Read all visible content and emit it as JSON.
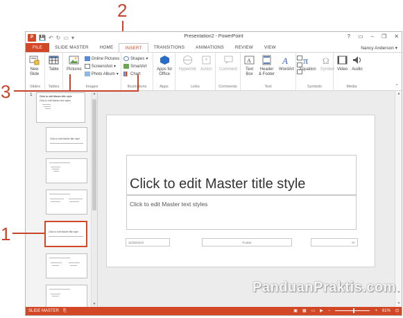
{
  "callouts": {
    "one": "1",
    "two": "2",
    "three": "3"
  },
  "window": {
    "title": "Presentation2 - PowerPoint",
    "help": "?",
    "min": "–",
    "restore": "❐",
    "close": "✕"
  },
  "tabs": {
    "file": "FILE",
    "slide_master": "SLIDE MASTER",
    "home": "HOME",
    "insert": "INSERT",
    "transitions": "TRANSITIONS",
    "animations": "ANIMATIONS",
    "review": "REVIEW",
    "view": "VIEW"
  },
  "user": "Nancy Anderson",
  "ribbon": {
    "new_slide": "New\nSlide",
    "table": "Table",
    "pictures": "Pictures",
    "online_pictures": "Online Pictures",
    "screenshot": "Screenshot",
    "photo_album": "Photo Album",
    "shapes": "Shapes",
    "smartart": "SmartArt",
    "chart": "Chart",
    "apps_for_office": "Apps for\nOffice",
    "hyperlink": "Hyperlink",
    "action": "Action",
    "comment": "Comment",
    "text_box": "Text\nBox",
    "header_footer": "Header\n& Footer",
    "wordart": "WordArt",
    "equation": "Equation",
    "symbol": "Symbol",
    "video": "Video",
    "audio": "Audio",
    "groups": {
      "slides": "Slides",
      "tables": "Tables",
      "images": "Images",
      "illustrations": "Illustrations",
      "apps": "Apps",
      "links": "Links",
      "comments": "Comments",
      "text": "Text",
      "symbols": "Symbols",
      "media": "Media"
    }
  },
  "thumbs": {
    "slide_number": "1",
    "master_title": "Click to edit Master title style",
    "master_text": "Click to edit Master text styles",
    "layout_title": "Click to edit Master title style"
  },
  "slide": {
    "title": "Click to edit Master title style",
    "body": "Click to edit Master text styles",
    "date": "11/25/2012",
    "footer": "Footer",
    "number": "‹#›"
  },
  "status": {
    "view": "SLIDE MASTER",
    "zoom": "61%"
  },
  "watermark": "PanduanPraktis.com"
}
